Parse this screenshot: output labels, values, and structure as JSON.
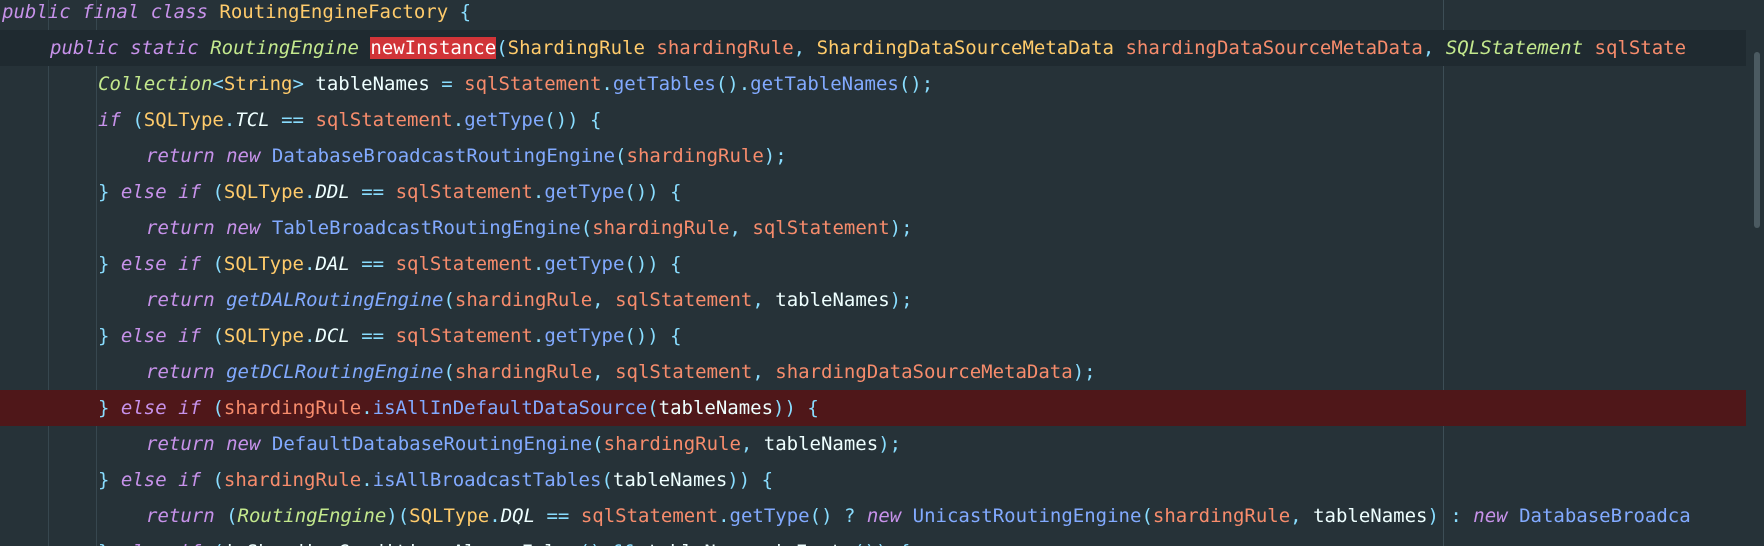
{
  "editor": {
    "language": "java",
    "lines": [
      {
        "tokens": [
          [
            "k",
            "public"
          ],
          [
            "v",
            " "
          ],
          [
            "k",
            "final"
          ],
          [
            "v",
            " "
          ],
          [
            "k",
            "class"
          ],
          [
            "v",
            " "
          ],
          [
            "t",
            "RoutingEngineFactory"
          ],
          [
            "v",
            " "
          ],
          [
            "o",
            "{"
          ]
        ]
      },
      {
        "tokens": [
          [
            "k",
            "public"
          ],
          [
            "v",
            " "
          ],
          [
            "k",
            "static"
          ],
          [
            "v",
            " "
          ],
          [
            "ti",
            "RoutingEngine"
          ],
          [
            "v",
            " "
          ],
          [
            "hlw",
            "newInstance"
          ],
          [
            "o",
            "("
          ],
          [
            "t",
            "ShardingRule"
          ],
          [
            "v",
            " "
          ],
          [
            "p",
            "shardingRule"
          ],
          [
            "o",
            ","
          ],
          [
            "v",
            " "
          ],
          [
            "t",
            "ShardingDataSourceMetaData"
          ],
          [
            "v",
            " "
          ],
          [
            "p",
            "shardingDataSourceMetaData"
          ],
          [
            "o",
            ","
          ],
          [
            "v",
            " "
          ],
          [
            "ti",
            "SQLStatement"
          ],
          [
            "v",
            " "
          ],
          [
            "p",
            "sqlState"
          ]
        ]
      },
      {
        "tokens": [
          [
            "ti",
            "Collection"
          ],
          [
            "o",
            "<"
          ],
          [
            "t",
            "String"
          ],
          [
            "o",
            ">"
          ],
          [
            "v",
            " tableNames "
          ],
          [
            "o",
            "="
          ],
          [
            "v",
            " "
          ],
          [
            "p",
            "sqlStatement"
          ],
          [
            "o",
            "."
          ],
          [
            "f",
            "getTables"
          ],
          [
            "o",
            "()."
          ],
          [
            "f",
            "getTableNames"
          ],
          [
            "o",
            "();"
          ]
        ]
      },
      {
        "tokens": [
          [
            "k",
            "if"
          ],
          [
            "v",
            " "
          ],
          [
            "o",
            "("
          ],
          [
            "t",
            "SQLType"
          ],
          [
            "o",
            "."
          ],
          [
            "c",
            "TCL"
          ],
          [
            "v",
            " "
          ],
          [
            "o",
            "=="
          ],
          [
            "v",
            " "
          ],
          [
            "p",
            "sqlStatement"
          ],
          [
            "o",
            "."
          ],
          [
            "f",
            "getType"
          ],
          [
            "o",
            "())"
          ],
          [
            "v",
            " "
          ],
          [
            "o",
            "{"
          ]
        ]
      },
      {
        "tokens": [
          [
            "k",
            "return"
          ],
          [
            "v",
            " "
          ],
          [
            "k",
            "new"
          ],
          [
            "v",
            " "
          ],
          [
            "f",
            "DatabaseBroadcastRoutingEngine"
          ],
          [
            "o",
            "("
          ],
          [
            "p",
            "shardingRule"
          ],
          [
            "o",
            ");"
          ]
        ]
      },
      {
        "tokens": [
          [
            "o",
            "}"
          ],
          [
            "v",
            " "
          ],
          [
            "k",
            "else"
          ],
          [
            "v",
            " "
          ],
          [
            "k",
            "if"
          ],
          [
            "v",
            " "
          ],
          [
            "o",
            "("
          ],
          [
            "t",
            "SQLType"
          ],
          [
            "o",
            "."
          ],
          [
            "c",
            "DDL"
          ],
          [
            "v",
            " "
          ],
          [
            "o",
            "=="
          ],
          [
            "v",
            " "
          ],
          [
            "p",
            "sqlStatement"
          ],
          [
            "o",
            "."
          ],
          [
            "f",
            "getType"
          ],
          [
            "o",
            "())"
          ],
          [
            "v",
            " "
          ],
          [
            "o",
            "{"
          ]
        ]
      },
      {
        "tokens": [
          [
            "k",
            "return"
          ],
          [
            "v",
            " "
          ],
          [
            "k",
            "new"
          ],
          [
            "v",
            " "
          ],
          [
            "f",
            "TableBroadcastRoutingEngine"
          ],
          [
            "o",
            "("
          ],
          [
            "p",
            "shardingRule"
          ],
          [
            "o",
            ","
          ],
          [
            "v",
            " "
          ],
          [
            "p",
            "sqlStatement"
          ],
          [
            "o",
            ");"
          ]
        ]
      },
      {
        "tokens": [
          [
            "o",
            "}"
          ],
          [
            "v",
            " "
          ],
          [
            "k",
            "else"
          ],
          [
            "v",
            " "
          ],
          [
            "k",
            "if"
          ],
          [
            "v",
            " "
          ],
          [
            "o",
            "("
          ],
          [
            "t",
            "SQLType"
          ],
          [
            "o",
            "."
          ],
          [
            "c",
            "DAL"
          ],
          [
            "v",
            " "
          ],
          [
            "o",
            "=="
          ],
          [
            "v",
            " "
          ],
          [
            "p",
            "sqlStatement"
          ],
          [
            "o",
            "."
          ],
          [
            "f",
            "getType"
          ],
          [
            "o",
            "())"
          ],
          [
            "v",
            " "
          ],
          [
            "o",
            "{"
          ]
        ]
      },
      {
        "tokens": [
          [
            "k",
            "return"
          ],
          [
            "v",
            " "
          ],
          [
            "fi",
            "getDALRoutingEngine"
          ],
          [
            "o",
            "("
          ],
          [
            "p",
            "shardingRule"
          ],
          [
            "o",
            ","
          ],
          [
            "v",
            " "
          ],
          [
            "p",
            "sqlStatement"
          ],
          [
            "o",
            ","
          ],
          [
            "v",
            " tableNames"
          ],
          [
            "o",
            ");"
          ]
        ]
      },
      {
        "tokens": [
          [
            "o",
            "}"
          ],
          [
            "v",
            " "
          ],
          [
            "k",
            "else"
          ],
          [
            "v",
            " "
          ],
          [
            "k",
            "if"
          ],
          [
            "v",
            " "
          ],
          [
            "o",
            "("
          ],
          [
            "t",
            "SQLType"
          ],
          [
            "o",
            "."
          ],
          [
            "c",
            "DCL"
          ],
          [
            "v",
            " "
          ],
          [
            "o",
            "=="
          ],
          [
            "v",
            " "
          ],
          [
            "p",
            "sqlStatement"
          ],
          [
            "o",
            "."
          ],
          [
            "f",
            "getType"
          ],
          [
            "o",
            "())"
          ],
          [
            "v",
            " "
          ],
          [
            "o",
            "{"
          ]
        ]
      },
      {
        "tokens": [
          [
            "k",
            "return"
          ],
          [
            "v",
            " "
          ],
          [
            "fi",
            "getDCLRoutingEngine"
          ],
          [
            "o",
            "("
          ],
          [
            "p",
            "shardingRule"
          ],
          [
            "o",
            ","
          ],
          [
            "v",
            " "
          ],
          [
            "p",
            "sqlStatement"
          ],
          [
            "o",
            ","
          ],
          [
            "v",
            " "
          ],
          [
            "p",
            "shardingDataSourceMetaData"
          ],
          [
            "o",
            ");"
          ]
        ]
      },
      {
        "tokens": [
          [
            "o",
            "}"
          ],
          [
            "v",
            " "
          ],
          [
            "k",
            "else"
          ],
          [
            "v",
            " "
          ],
          [
            "k",
            "if"
          ],
          [
            "v",
            " "
          ],
          [
            "o",
            "("
          ],
          [
            "p",
            "shardingRule"
          ],
          [
            "o",
            "."
          ],
          [
            "f",
            "isAllInDefaultDataSource"
          ],
          [
            "o",
            "("
          ],
          [
            "v",
            "tableNames"
          ],
          [
            "o",
            "))"
          ],
          [
            "v",
            " "
          ],
          [
            "o",
            "{"
          ]
        ]
      },
      {
        "tokens": [
          [
            "k",
            "return"
          ],
          [
            "v",
            " "
          ],
          [
            "k",
            "new"
          ],
          [
            "v",
            " "
          ],
          [
            "f",
            "DefaultDatabaseRoutingEngine"
          ],
          [
            "o",
            "("
          ],
          [
            "p",
            "shardingRule"
          ],
          [
            "o",
            ","
          ],
          [
            "v",
            " tableNames"
          ],
          [
            "o",
            ");"
          ]
        ]
      },
      {
        "tokens": [
          [
            "o",
            "}"
          ],
          [
            "v",
            " "
          ],
          [
            "k",
            "else"
          ],
          [
            "v",
            " "
          ],
          [
            "k",
            "if"
          ],
          [
            "v",
            " "
          ],
          [
            "o",
            "("
          ],
          [
            "p",
            "shardingRule"
          ],
          [
            "o",
            "."
          ],
          [
            "f",
            "isAllBroadcastTables"
          ],
          [
            "o",
            "("
          ],
          [
            "v",
            "tableNames"
          ],
          [
            "o",
            "))"
          ],
          [
            "v",
            " "
          ],
          [
            "o",
            "{"
          ]
        ]
      },
      {
        "tokens": [
          [
            "k",
            "return"
          ],
          [
            "v",
            " "
          ],
          [
            "o",
            "("
          ],
          [
            "ti",
            "RoutingEngine"
          ],
          [
            "o",
            ")("
          ],
          [
            "t",
            "SQLType"
          ],
          [
            "o",
            "."
          ],
          [
            "c",
            "DQL"
          ],
          [
            "v",
            " "
          ],
          [
            "o",
            "=="
          ],
          [
            "v",
            " "
          ],
          [
            "p",
            "sqlStatement"
          ],
          [
            "o",
            "."
          ],
          [
            "f",
            "getType"
          ],
          [
            "o",
            "()"
          ],
          [
            "v",
            " "
          ],
          [
            "o",
            "?"
          ],
          [
            "v",
            " "
          ],
          [
            "k",
            "new"
          ],
          [
            "v",
            " "
          ],
          [
            "f",
            "UnicastRoutingEngine"
          ],
          [
            "o",
            "("
          ],
          [
            "p",
            "shardingRule"
          ],
          [
            "o",
            ","
          ],
          [
            "v",
            " tableNames"
          ],
          [
            "o",
            ")"
          ],
          [
            "v",
            " "
          ],
          [
            "o",
            ":"
          ],
          [
            "v",
            " "
          ],
          [
            "k",
            "new"
          ],
          [
            "v",
            " "
          ],
          [
            "f",
            "DatabaseBroadca"
          ]
        ]
      },
      {
        "tokens": [
          [
            "o",
            "}"
          ],
          [
            "v",
            " "
          ],
          [
            "k",
            "else"
          ],
          [
            "v",
            " "
          ],
          [
            "k",
            "if"
          ],
          [
            "v",
            " "
          ],
          [
            "o",
            "("
          ],
          [
            "v",
            "isShardingConditionsAlwaysFalse"
          ],
          [
            "o",
            "()"
          ],
          [
            "v",
            " "
          ],
          [
            "o",
            "&&"
          ],
          [
            "v",
            " tableNames.isEmpty"
          ],
          [
            "o",
            "())"
          ],
          [
            "v",
            " "
          ],
          [
            "o",
            "{"
          ]
        ]
      }
    ]
  }
}
